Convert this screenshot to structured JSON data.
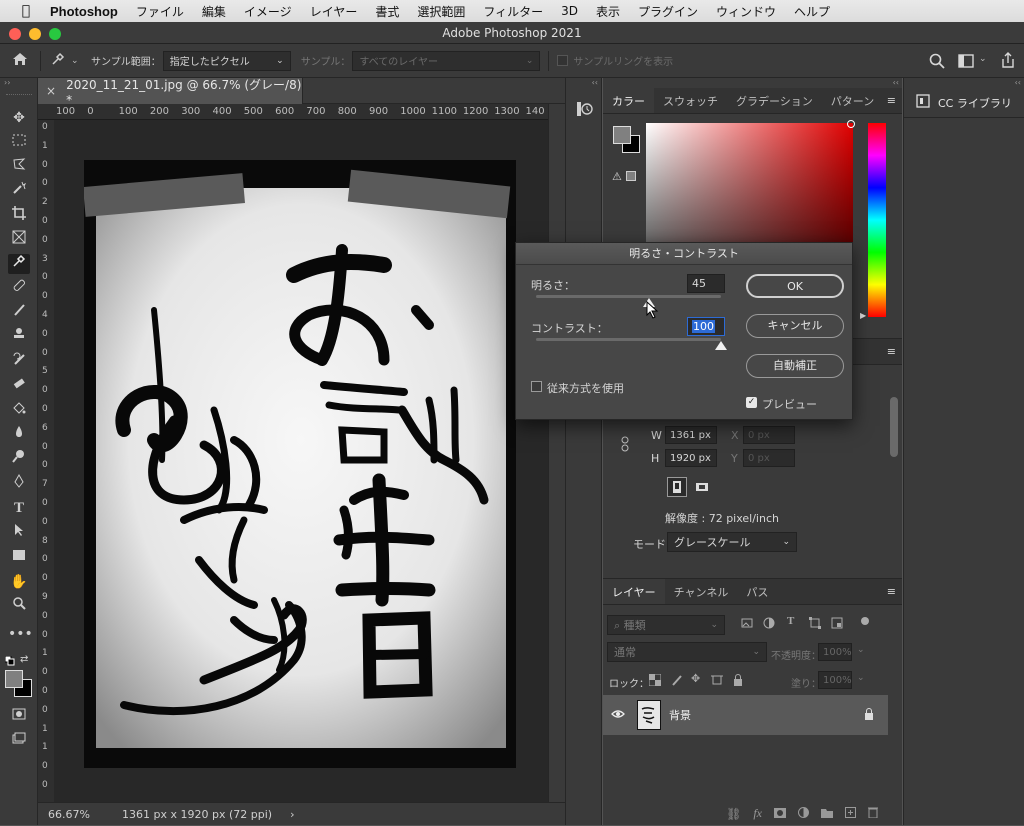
{
  "menubar": {
    "app_name": "Photoshop",
    "items": [
      "ファイル",
      "編集",
      "イメージ",
      "レイヤー",
      "書式",
      "選択範囲",
      "フィルター",
      "3D",
      "表示",
      "プラグイン",
      "ウィンドウ",
      "ヘルプ"
    ]
  },
  "window": {
    "title": "Adobe Photoshop 2021"
  },
  "options": {
    "sample_range_label": "サンプル範囲：",
    "sample_range_value": "指定したピクセル",
    "sample_label": "サンプル：",
    "sample_value": "すべてのレイヤー",
    "sampling_ring_label": "サンプルリングを表示"
  },
  "document": {
    "tab_title": "2020_11_21_01.jpg @ 66.7% (グレー/8) *",
    "ruler_h": [
      "100",
      "0",
      "100",
      "200",
      "300",
      "400",
      "500",
      "600",
      "700",
      "800",
      "900",
      "1000",
      "1100",
      "1200",
      "1300",
      "140"
    ],
    "ruler_v": [
      "0",
      "1",
      "0",
      "0",
      "2",
      "0",
      "0",
      "3",
      "0",
      "0",
      "4",
      "0",
      "0",
      "5",
      "0",
      "0",
      "6",
      "0",
      "0",
      "7",
      "0",
      "0",
      "8",
      "0",
      "0",
      "9",
      "0",
      "0",
      "1",
      "0",
      "0",
      "0",
      "1",
      "1",
      "0",
      "0"
    ],
    "status_zoom": "66.67%",
    "status_info": "1361 px x 1920 px (72 ppi)"
  },
  "color_panel": {
    "tabs": [
      "カラー",
      "スウォッチ",
      "グラデーション",
      "パターン"
    ]
  },
  "properties": {
    "w_label": "W",
    "w_value": "1361 px",
    "x_label": "X",
    "x_value": "0 px",
    "h_label": "H",
    "h_value": "1920 px",
    "y_label": "Y",
    "y_value": "0 px",
    "resolution": "解像度 : 72 pixel/inch",
    "mode_label": "モード",
    "mode_value": "グレースケール"
  },
  "layers_panel": {
    "tabs": [
      "レイヤー",
      "チャンネル",
      "パス"
    ],
    "filter_placeholder": "種類",
    "blend_mode": "通常",
    "opacity_label": "不透明度：",
    "opacity_value": "100%",
    "lock_label": "ロック：",
    "fill_label": "塗り：",
    "fill_value": "100%",
    "layer_name": "背景"
  },
  "cc_library": {
    "label": "CC ライブラリ"
  },
  "dialog": {
    "title": "明るさ・コントラスト",
    "brightness_label": "明るさ：",
    "brightness_value": "45",
    "brightness_level": 0.61,
    "contrast_label": "コントラスト：",
    "contrast_value": "100",
    "contrast_level": 1.0,
    "legacy_label": "従来方式を使用",
    "legacy_checked": false,
    "ok_label": "OK",
    "cancel_label": "キャンセル",
    "auto_label": "自動補正",
    "preview_label": "プレビュー",
    "preview_checked": true
  },
  "colors": {
    "accent_blue": "#2d6bd6",
    "panel_bg": "#3a3a3a",
    "canvas_bg": "#282828"
  }
}
